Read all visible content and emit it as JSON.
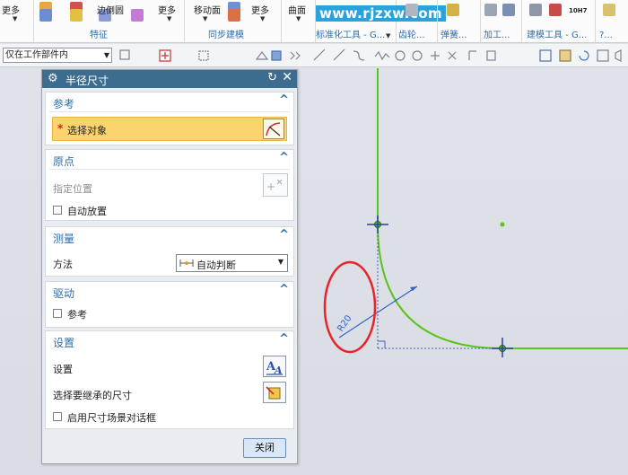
{
  "ribbon": {
    "more_1": "更多",
    "fillet_edge": "边倒圆",
    "more_2": "更多",
    "features_group": "特征",
    "move_face": "移动面",
    "more_3": "更多",
    "sync_group": "同步建模",
    "surface": "曲面",
    "std_parts": "标准化工具 - G...",
    "gear": "齿轮...",
    "spring": "弹簧...",
    "machining": "加工...",
    "modeling_tools": "建模工具 - G...",
    "more_4": "?...",
    "badge_10h7": "10H7",
    "watermark": "www.rjzxw.com"
  },
  "toolbar2": {
    "selection_filter": "仅在工作部件内"
  },
  "dialog": {
    "title": "半径尺寸",
    "sections": {
      "reference": {
        "title": "参考",
        "select_object": "选择对象"
      },
      "origin": {
        "title": "原点",
        "specify_location": "指定位置",
        "auto_place": "自动放置"
      },
      "measurement": {
        "title": "测量",
        "method_label": "方法",
        "method_value": "自动判断"
      },
      "driving": {
        "title": "驱动",
        "reference": "参考"
      },
      "settings": {
        "title": "设置",
        "settings_label": "设置",
        "inherit_label": "选择要继承的尺寸",
        "enable_dialog": "启用尺寸场景对话框"
      }
    },
    "close_button": "关闭"
  },
  "canvas": {
    "dimension_text": "R20"
  },
  "colors": {
    "geometry": "#5cc21f",
    "dimension": "#2f5fc8",
    "highlight": "#e8232a",
    "title_bar": "#3c6d8f",
    "section_title": "#2f6fa8",
    "selection_row": "#fcd46e"
  }
}
